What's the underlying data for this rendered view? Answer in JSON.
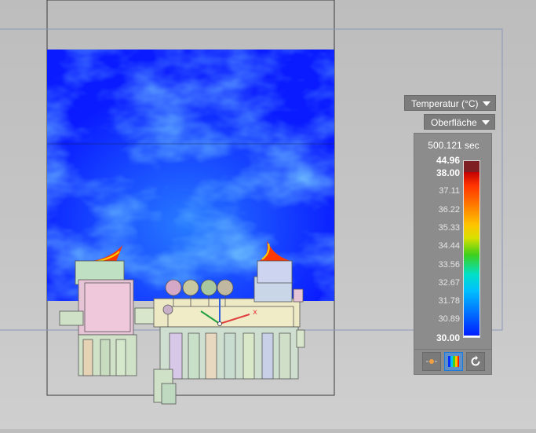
{
  "legend": {
    "quantity_label": "Temperatur (°C)",
    "surface_label": "Oberfläche",
    "time": "500.121 sec",
    "max_value": "44.96",
    "ticks": [
      "38.00",
      "37.11",
      "36.22",
      "35.33",
      "34.44",
      "33.56",
      "32.67",
      "31.78",
      "30.89",
      "30.00"
    ]
  },
  "toolbar": {
    "buttons": [
      {
        "icon": "light-icon"
      },
      {
        "icon": "colormap-icon",
        "active": true
      },
      {
        "icon": "reset-icon"
      }
    ]
  },
  "colors": {
    "field_low": "#0a1cff",
    "field_mid": "#22b8ff",
    "field_high": "#ff2a00",
    "panel_bg": "#8c8c8c",
    "overrange": "#7d1f23"
  }
}
